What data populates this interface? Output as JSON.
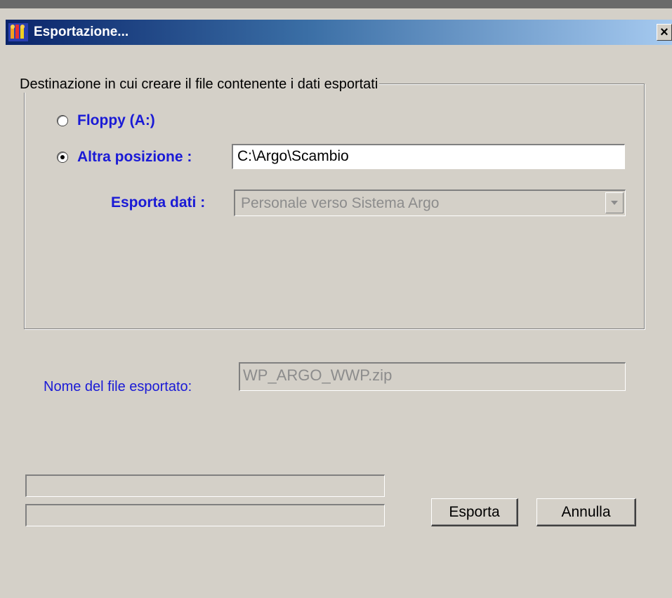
{
  "window": {
    "title": "Esportazione...",
    "close_glyph": "×"
  },
  "destination": {
    "legend": "Destinazione in cui creare il file contenente i dati esportati",
    "options": [
      {
        "label": "Floppy (A:)",
        "selected": false
      },
      {
        "label": "Altra posizione :",
        "selected": true
      }
    ],
    "path_value": "C:\\Argo\\Scambio",
    "export_label": "Esporta dati :",
    "export_value": "Personale verso Sistema Argo"
  },
  "filename": {
    "label": "Nome del file esportato:",
    "value": "WP_ARGO_WWP.zip"
  },
  "progress": [
    {
      "fraction": 0
    },
    {
      "fraction": 0
    }
  ],
  "buttons": {
    "export": "Esporta",
    "cancel": "Annulla"
  },
  "colors": {
    "label_blue": "#1a1ad6",
    "disabled_text": "#8c8c8c",
    "face": "#d4d0c8",
    "title_start": "#0a246a",
    "title_end": "#a6caf0"
  },
  "icons": [
    "app-icon",
    "close-icon",
    "dropdown-arrow-icon"
  ]
}
